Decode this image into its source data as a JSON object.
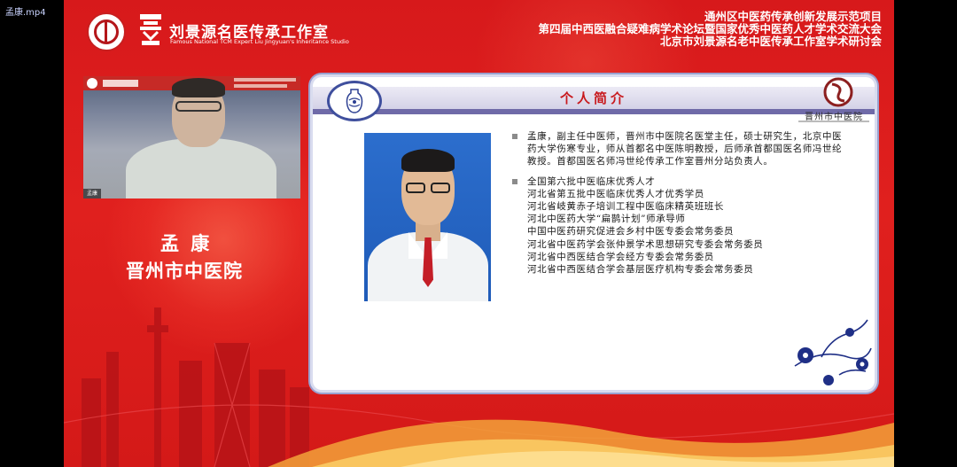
{
  "window": {
    "file_label": "孟康.mp4"
  },
  "header": {
    "studio_title": "刘景源名医传承工作室",
    "studio_subtitle": "Famous National TCM Expert Liu Jingyuan's Inheritance Studio",
    "lines": [
      "通州区中医药传承创新发展示范项目",
      "第四届中西医融合疑难病学术论坛暨国家优秀中医药人才学术交流大会",
      "北京市刘景源名老中医传承工作室学术研讨会"
    ]
  },
  "webcam": {
    "name_tag": "孟康"
  },
  "speaker": {
    "name": "孟 康",
    "hospital": "晋州市中医院"
  },
  "slide": {
    "title": "个人简介",
    "hospital_logo_name": "晋州市中医院",
    "intro": "孟康，副主任中医师，晋州市中医院名医堂主任，硕士研究生，北京中医药大学伤寒专业，师从首都名中医陈明教授，后师承首都国医名师冯世纶教授。首都国医名师冯世纶传承工作室晋州分站负责人。",
    "honors": [
      "全国第六批中医临床优秀人才",
      "河北省第五批中医临床优秀人才优秀学员",
      "河北省岐黄赤子培训工程中医临床精英班班长",
      "河北中医药大学“扁鹊计划”师承导师",
      "中国中医药研究促进会乡村中医专委会常务委员",
      "河北省中医药学会张仲景学术思想研究专委会常务委员",
      "河北省中西医结合学会经方专委会常务委员",
      "河北省中西医结合学会基层医疗机构专委会常务委员"
    ]
  },
  "colors": {
    "background_red": "#d7191b",
    "slide_title_red": "#c8191d",
    "slide_band_purple": "#6f6aa8"
  },
  "icons": {
    "vase": "blue-white-porcelain-vase-icon",
    "hospital_logo": "hospital-logo-icon",
    "floral": "floral-ornament-icon"
  }
}
